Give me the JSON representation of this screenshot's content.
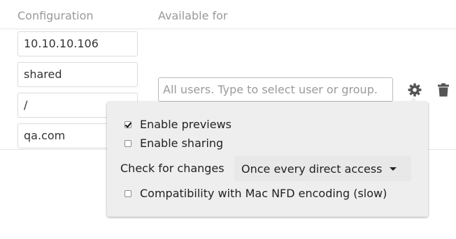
{
  "table": {
    "headers": {
      "configuration": "Configuration",
      "available_for": "Available for"
    },
    "row": {
      "config_fields": [
        "10.10.10.106",
        "shared",
        "/",
        "qa.com"
      ],
      "available_for_placeholder": "All users. Type to select user or group.",
      "actions": {
        "settings_icon": "gear-icon",
        "delete_icon": "trash-icon"
      }
    }
  },
  "options_popover": {
    "enable_previews": {
      "label": "Enable previews",
      "checked": true
    },
    "enable_sharing": {
      "label": "Enable sharing",
      "checked": false
    },
    "check_for_changes": {
      "label": "Check for changes",
      "selected": "Once every direct access"
    },
    "mac_nfd": {
      "label": "Compatibility with Mac NFD encoding (slow)",
      "checked": false
    }
  },
  "colors": {
    "header_text": "#999999",
    "popover_bg": "#eeeeee",
    "icon": "#555555"
  }
}
